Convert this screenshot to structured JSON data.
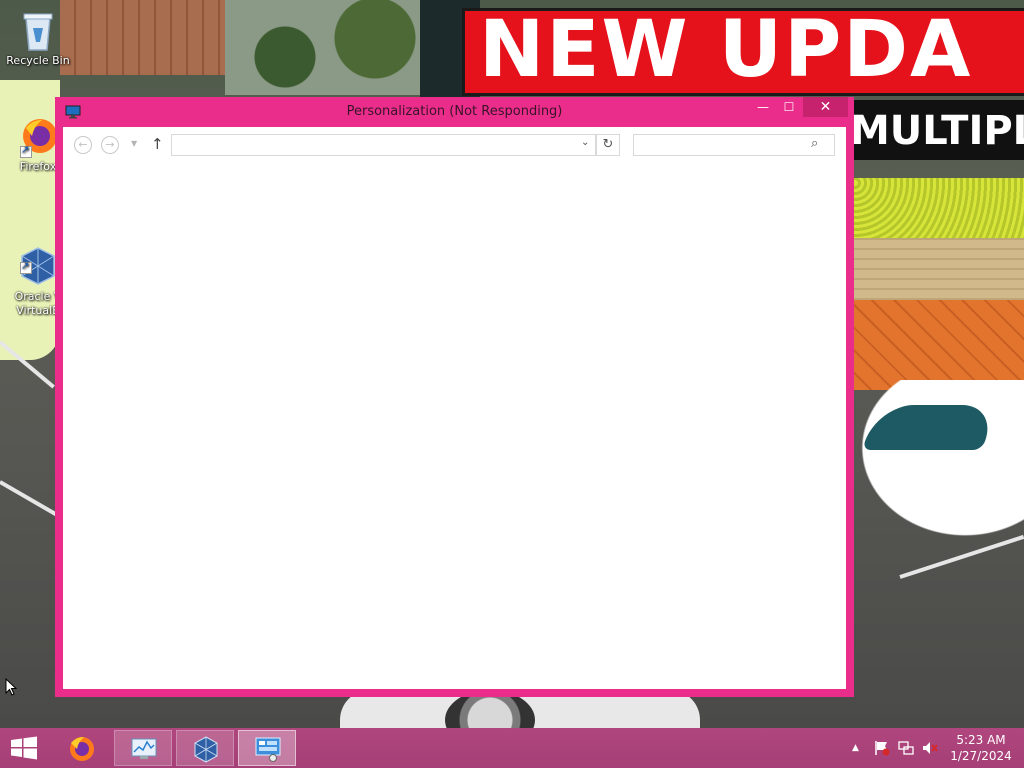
{
  "wallpaper": {
    "banner_text": "NEW UPDA",
    "sub_banner_text": "MULTIPL"
  },
  "desktop_icons": [
    {
      "label": "Recycle Bin",
      "icon": "recycle-bin-icon"
    },
    {
      "label": "Firefox",
      "icon": "firefox-icon"
    },
    {
      "label": "Oracle V\nVirtualB",
      "icon": "virtualbox-icon"
    }
  ],
  "window": {
    "title": "Personalization (Not Responding)",
    "minimize_glyph": "—",
    "maximize_glyph": "☐",
    "close_glyph": "✕",
    "address_value": "",
    "search_placeholder": "",
    "accent_color": "#ea2c8b"
  },
  "taskbar": {
    "apps": [
      {
        "name": "Firefox",
        "icon": "firefox-icon"
      },
      {
        "name": "Performance Monitor",
        "icon": "performance-monitor-icon"
      },
      {
        "name": "Oracle VM VirtualBox",
        "icon": "virtualbox-icon"
      },
      {
        "name": "Control Panel",
        "icon": "control-panel-icon",
        "active": true
      }
    ],
    "clock": {
      "time": "5:23 AM",
      "date": "1/27/2024"
    }
  }
}
